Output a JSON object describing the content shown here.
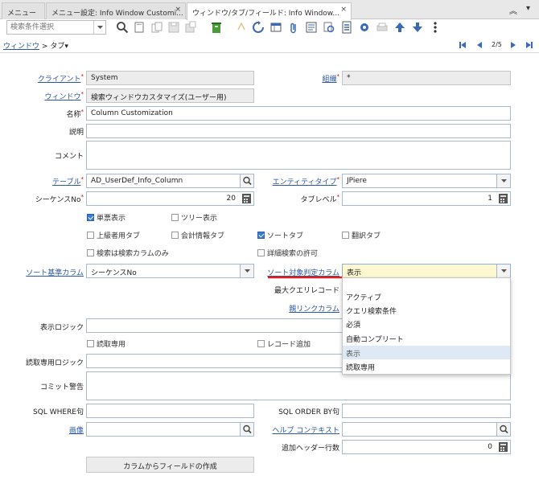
{
  "tabs": [
    {
      "label": "メニュー"
    },
    {
      "label": "メニュー設定: Info Window Customi...",
      "close": "×"
    },
    {
      "label": "ウィンドウ/タブ/フィールド: Info Window...",
      "close": "×"
    }
  ],
  "toolbar": {
    "search_placeholder": "検索条件選択"
  },
  "breadcrumb": {
    "window": "ウィンドウ",
    "sep": ">",
    "tab": "タブ"
  },
  "record_nav": {
    "position": "2/5"
  },
  "fields": {
    "client": {
      "label": "クライアント",
      "value": "System"
    },
    "org": {
      "label": "組織",
      "value": "*"
    },
    "window": {
      "label": "ウィンドウ",
      "value": "検索ウィンドウカスタマイズ(ユーザー用)"
    },
    "name": {
      "label": "名称",
      "value": "Column Customization"
    },
    "description": {
      "label": "説明",
      "value": ""
    },
    "comment": {
      "label": "コメント",
      "value": ""
    },
    "table": {
      "label": "テーブル",
      "value": "AD_UserDef_Info_Column"
    },
    "entity_type": {
      "label": "エンティティタイプ",
      "value": "JPiere"
    },
    "sequence": {
      "label": "シーケンスNo",
      "value": "20"
    },
    "tab_level": {
      "label": "タブレベル",
      "value": "1"
    },
    "sort_column": {
      "label": "ソート基準カラム",
      "value": "シーケンスNo"
    },
    "sort_yes_no_column": {
      "label": "ソート対象判定カラム",
      "value": "表示"
    },
    "max_query_records": {
      "label": "最大クエリレコード"
    },
    "parent_link_column": {
      "label": "親リンクカラム"
    },
    "display_logic": {
      "label": "表示ロジック",
      "value": ""
    },
    "readonly_logic": {
      "label": "読取専用ロジック",
      "value": ""
    },
    "commit_warning": {
      "label": "コミット警告",
      "value": ""
    },
    "sql_where": {
      "label": "SQL WHERE句",
      "value": ""
    },
    "sql_order_by": {
      "label": "SQL ORDER BY句",
      "value": ""
    },
    "image": {
      "label": "画像",
      "value": ""
    },
    "help_context": {
      "label": "ヘルプ コンテキスト",
      "value": ""
    },
    "header_rows": {
      "label": "追加ヘッダー行数",
      "value": "0"
    }
  },
  "checkboxes": {
    "single_row": {
      "label": "単票表示",
      "checked": true
    },
    "tree_display": {
      "label": "ツリー表示",
      "checked": false
    },
    "advanced_tab": {
      "label": "上級者用タブ",
      "checked": false
    },
    "accounting_tab": {
      "label": "会計情報タブ",
      "checked": false
    },
    "sort_tab": {
      "label": "ソートタブ",
      "checked": true
    },
    "translation_tab": {
      "label": "翻訳タブ",
      "checked": false
    },
    "search_columns_only": {
      "label": "検索は検索カラムのみ",
      "checked": false
    },
    "allow_advanced_search": {
      "label": "詳細検索の許可",
      "checked": false
    },
    "read_only": {
      "label": "読取専用",
      "checked": false
    },
    "insert_record": {
      "label": "レコード追加",
      "checked": false
    }
  },
  "dropdown_options": [
    "アクティブ",
    "クエリ検索条件",
    "必須",
    "自動コンプリート",
    "表示",
    "読取専用"
  ],
  "dropdown_selected_index": 4,
  "create_fields_button": "カラムからフィールドの作成",
  "colors": {
    "accent_blue": "#2c56a6",
    "icon_blue": "#3a6ab5",
    "underline_red": "#e02020",
    "highlight_field": "#fdf8d0"
  }
}
